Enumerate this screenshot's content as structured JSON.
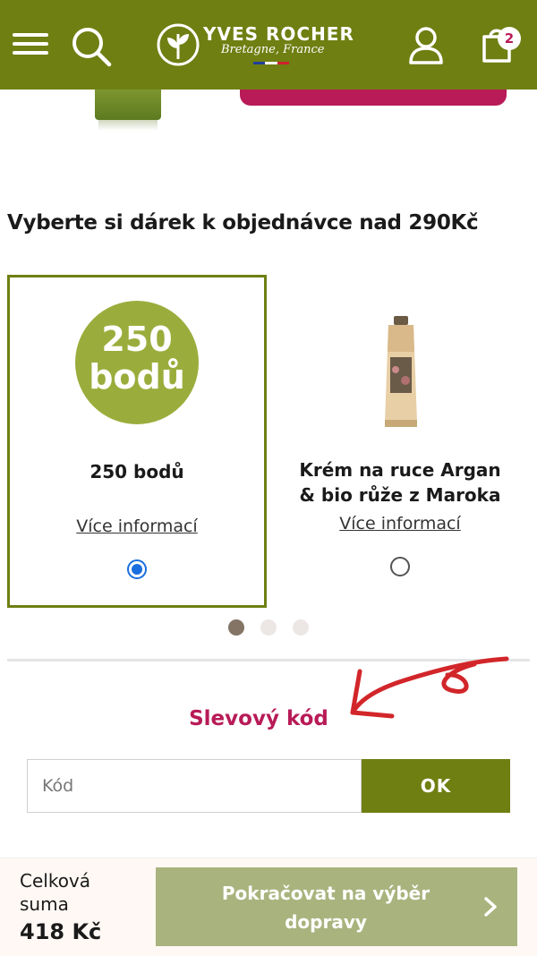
{
  "header": {
    "brand_name": "YVES ROCHER",
    "brand_subtitle": "Bretagne, France",
    "cart_count": "2",
    "flag_colors": [
      "#1f3f9a",
      "#ffffff",
      "#d0202e"
    ],
    "background_color": "#6f7f12",
    "icons": [
      "hamburger-menu-icon",
      "search-icon",
      "user-icon",
      "shopping-bag-icon"
    ]
  },
  "gift_section": {
    "title": "Vyberte si dárek k objednávce nad 290Kč",
    "items": [
      {
        "badge_line1": "250",
        "badge_line2": "bodů",
        "name": "250 bodů",
        "link": "Více informací",
        "selected": true
      },
      {
        "name_line1": "Krém na ruce Argan",
        "name_line2": "& bio růže z Maroka",
        "link": "Více informací",
        "selected": false
      }
    ],
    "carousel": {
      "pages": 3,
      "active_page": 1
    }
  },
  "discount": {
    "title": "Slevový kód",
    "input_placeholder": "Kód",
    "button_label": "OK"
  },
  "footer": {
    "total_label": "Celková suma",
    "total_value": "418 Kč",
    "continue_label": "Pokračovat na výběr dopravy"
  },
  "colors": {
    "brand_green": "#6f7f12",
    "accent_pink": "#b81b57",
    "points_green": "#9aad3c",
    "continue_disabled": "#a9b37e",
    "arrow_red": "#d2262a"
  }
}
